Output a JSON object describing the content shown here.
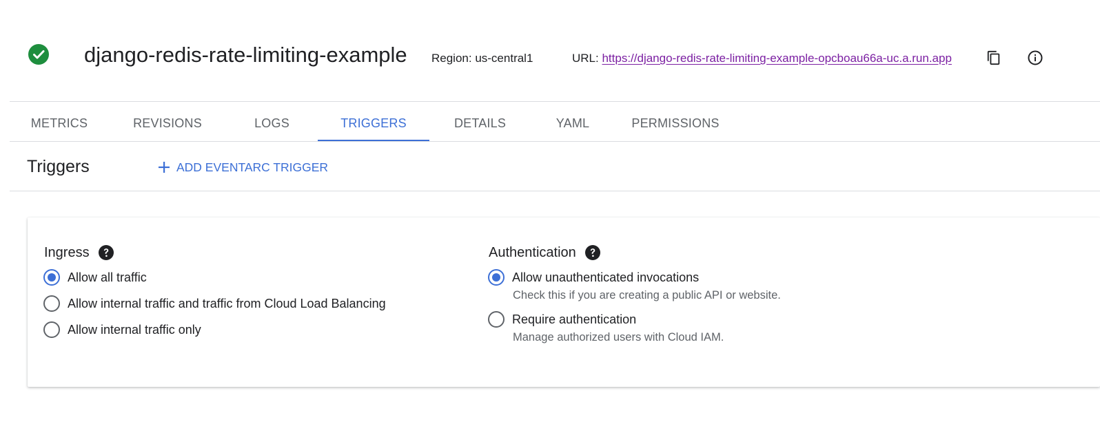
{
  "header": {
    "service_name": "django-redis-rate-limiting-example",
    "region_text": "Region: us-central1",
    "url_label": "URL: ",
    "url": "https://django-redis-rate-limiting-example-opcboau66a-uc.a.run.app",
    "status_icon": "check-circle-icon",
    "copy_icon": "copy-icon",
    "info_icon": "info-icon"
  },
  "tabs": [
    {
      "label": "METRICS",
      "active": false
    },
    {
      "label": "REVISIONS",
      "active": false
    },
    {
      "label": "LOGS",
      "active": false
    },
    {
      "label": "TRIGGERS",
      "active": true
    },
    {
      "label": "DETAILS",
      "active": false
    },
    {
      "label": "YAML",
      "active": false
    },
    {
      "label": "PERMISSIONS",
      "active": false
    }
  ],
  "triggers": {
    "title": "Triggers",
    "add_button_label": "ADD EVENTARC TRIGGER"
  },
  "ingress": {
    "title": "Ingress",
    "options": [
      {
        "label": "Allow all traffic",
        "selected": true
      },
      {
        "label": "Allow internal traffic and traffic from Cloud Load Balancing",
        "selected": false
      },
      {
        "label": "Allow internal traffic only",
        "selected": false
      }
    ]
  },
  "authentication": {
    "title": "Authentication",
    "options": [
      {
        "label": "Allow unauthenticated invocations",
        "description": "Check this if you are creating a public API or website.",
        "selected": true
      },
      {
        "label": "Require authentication",
        "description": "Manage authorized users with Cloud IAM.",
        "selected": false
      }
    ]
  },
  "colors": {
    "accent": "#3c6fd6",
    "success": "#1e8e3e",
    "link_visited": "#7b1fa2",
    "text_primary": "#202124",
    "text_secondary": "#5f6368"
  }
}
